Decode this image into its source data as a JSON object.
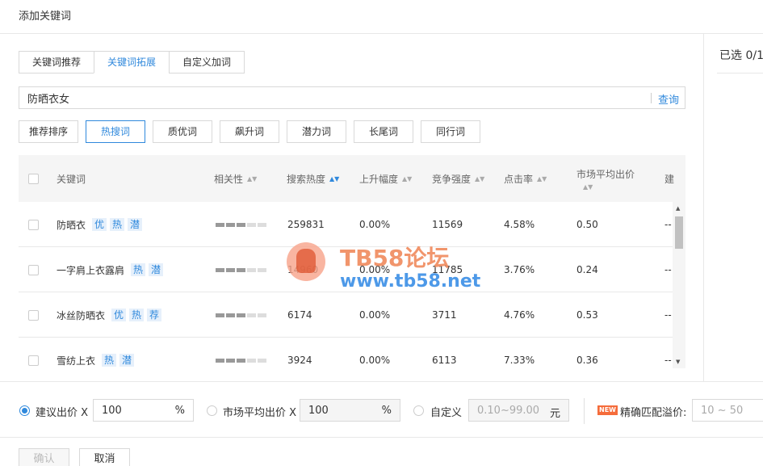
{
  "dialog": {
    "title": "添加关键词"
  },
  "tabs": [
    {
      "label": "关键词推荐",
      "active": false
    },
    {
      "label": "关键词拓展",
      "active": true
    },
    {
      "label": "自定义加词",
      "active": false
    }
  ],
  "search": {
    "value": "防晒衣女",
    "button_label": "查询"
  },
  "filters": [
    {
      "label": "推荐排序",
      "active": false
    },
    {
      "label": "热搜词",
      "active": true
    },
    {
      "label": "质优词",
      "active": false
    },
    {
      "label": "飙升词",
      "active": false
    },
    {
      "label": "潜力词",
      "active": false
    },
    {
      "label": "长尾词",
      "active": false
    },
    {
      "label": "同行词",
      "active": false
    }
  ],
  "table": {
    "columns": {
      "keyword": "关键词",
      "relevance": "相关性",
      "search_heat": "搜索热度",
      "rise": "上升幅度",
      "competition": "竞争强度",
      "ctr": "点击率",
      "market_bid": "市场平均出价",
      "suggest": "建"
    },
    "rows": [
      {
        "keyword": "防晒衣",
        "tags": [
          "优",
          "热",
          "潜"
        ],
        "relevance_level": 3,
        "search_heat": "259831",
        "rise": "0.00%",
        "competition": "11569",
        "ctr": "4.58%",
        "market_bid": "0.50",
        "suggest": "--"
      },
      {
        "keyword": "一字肩上衣露肩",
        "tags": [
          "热",
          "潜"
        ],
        "relevance_level": 3,
        "search_heat": "14960",
        "rise": "0.00%",
        "competition": "11785",
        "ctr": "3.76%",
        "market_bid": "0.24",
        "suggest": "--"
      },
      {
        "keyword": "冰丝防晒衣",
        "tags": [
          "优",
          "热",
          "荐"
        ],
        "relevance_level": 3,
        "search_heat": "6174",
        "rise": "0.00%",
        "competition": "3711",
        "ctr": "4.76%",
        "market_bid": "0.53",
        "suggest": "--"
      },
      {
        "keyword": "雪纺上衣",
        "tags": [
          "热",
          "潜"
        ],
        "relevance_level": 3,
        "search_heat": "3924",
        "rise": "0.00%",
        "competition": "6113",
        "ctr": "7.33%",
        "market_bid": "0.36",
        "suggest": "--"
      }
    ]
  },
  "selected_panel": {
    "title": "已选 0/1"
  },
  "watermark": {
    "line1": "TB58论坛",
    "line2": "www.tb58.net"
  },
  "bid": {
    "suggested_label": "建议出价 X",
    "suggested_value": "100",
    "suggested_unit": "%",
    "market_label": "市场平均出价 X",
    "market_value": "100",
    "market_unit": "%",
    "custom_label": "自定义",
    "custom_placeholder": "0.10~99.00",
    "custom_unit": "元",
    "new_badge": "NEW",
    "exact_label": "精确匹配溢价:",
    "exact_placeholder": "10 ~ 50"
  },
  "footer": {
    "confirm_label": "确认",
    "cancel_label": "取消"
  },
  "colors": {
    "accent": "#3089dc",
    "tag_bg": "#e6f0fb",
    "header_bg": "#f5f5f5"
  }
}
